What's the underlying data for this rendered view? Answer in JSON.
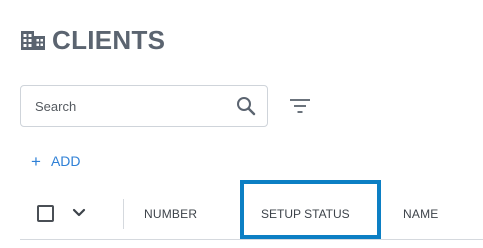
{
  "page": {
    "title": "CLIENTS",
    "title_icon": "building-icon"
  },
  "search": {
    "placeholder": "Search",
    "value": "",
    "icon": "search-icon"
  },
  "filter": {
    "icon": "filter-icon"
  },
  "add": {
    "icon": "+",
    "label": "ADD"
  },
  "table": {
    "columns": [
      "NUMBER",
      "SETUP STATUS",
      "NAME"
    ],
    "highlighted_column": "SETUP STATUS"
  },
  "colors": {
    "accent": "#2f80d6",
    "highlight": "#0c7fc4",
    "title": "#5b6470"
  }
}
